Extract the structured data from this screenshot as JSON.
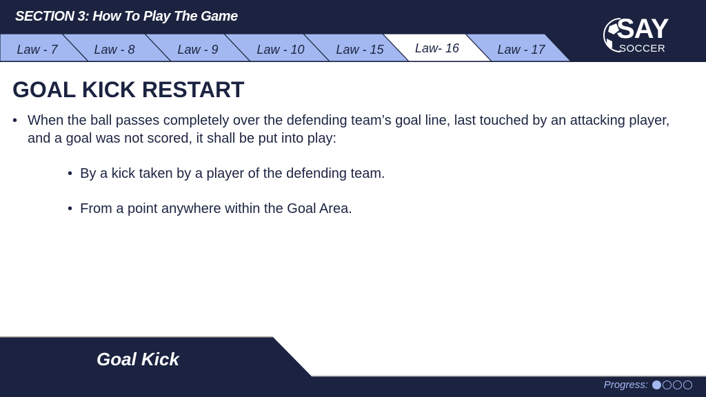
{
  "header": {
    "section_title": "SECTION 3:  How To Play The Game"
  },
  "tabs": [
    {
      "label": "Law - 7",
      "active": false
    },
    {
      "label": "Law - 8",
      "active": false
    },
    {
      "label": "Law - 9",
      "active": false
    },
    {
      "label": "Law - 10",
      "active": false
    },
    {
      "label": "Law - 15",
      "active": false
    },
    {
      "label": "Law- 16",
      "active": true
    },
    {
      "label": "Law - 17",
      "active": false
    }
  ],
  "logo": {
    "text_main": "SAY",
    "text_sub": "SOCCER"
  },
  "content": {
    "title": "GOAL KICK RESTART",
    "bullet_main": "When the ball passes completely over the defending team’s goal line, last touched by an attacking player, and a goal was not scored, it shall be put into play:",
    "sub_bullets": [
      "By a kick taken by a player of the defending team.",
      "From a point anywhere within the Goal Area."
    ]
  },
  "footer": {
    "label": "Goal Kick",
    "progress_label": "Progress:",
    "progress_step": 1,
    "progress_total": 4
  },
  "colors": {
    "navy": "#1b2340",
    "tab_blue": "#a3b8f0",
    "active_tab": "#ffffff"
  }
}
